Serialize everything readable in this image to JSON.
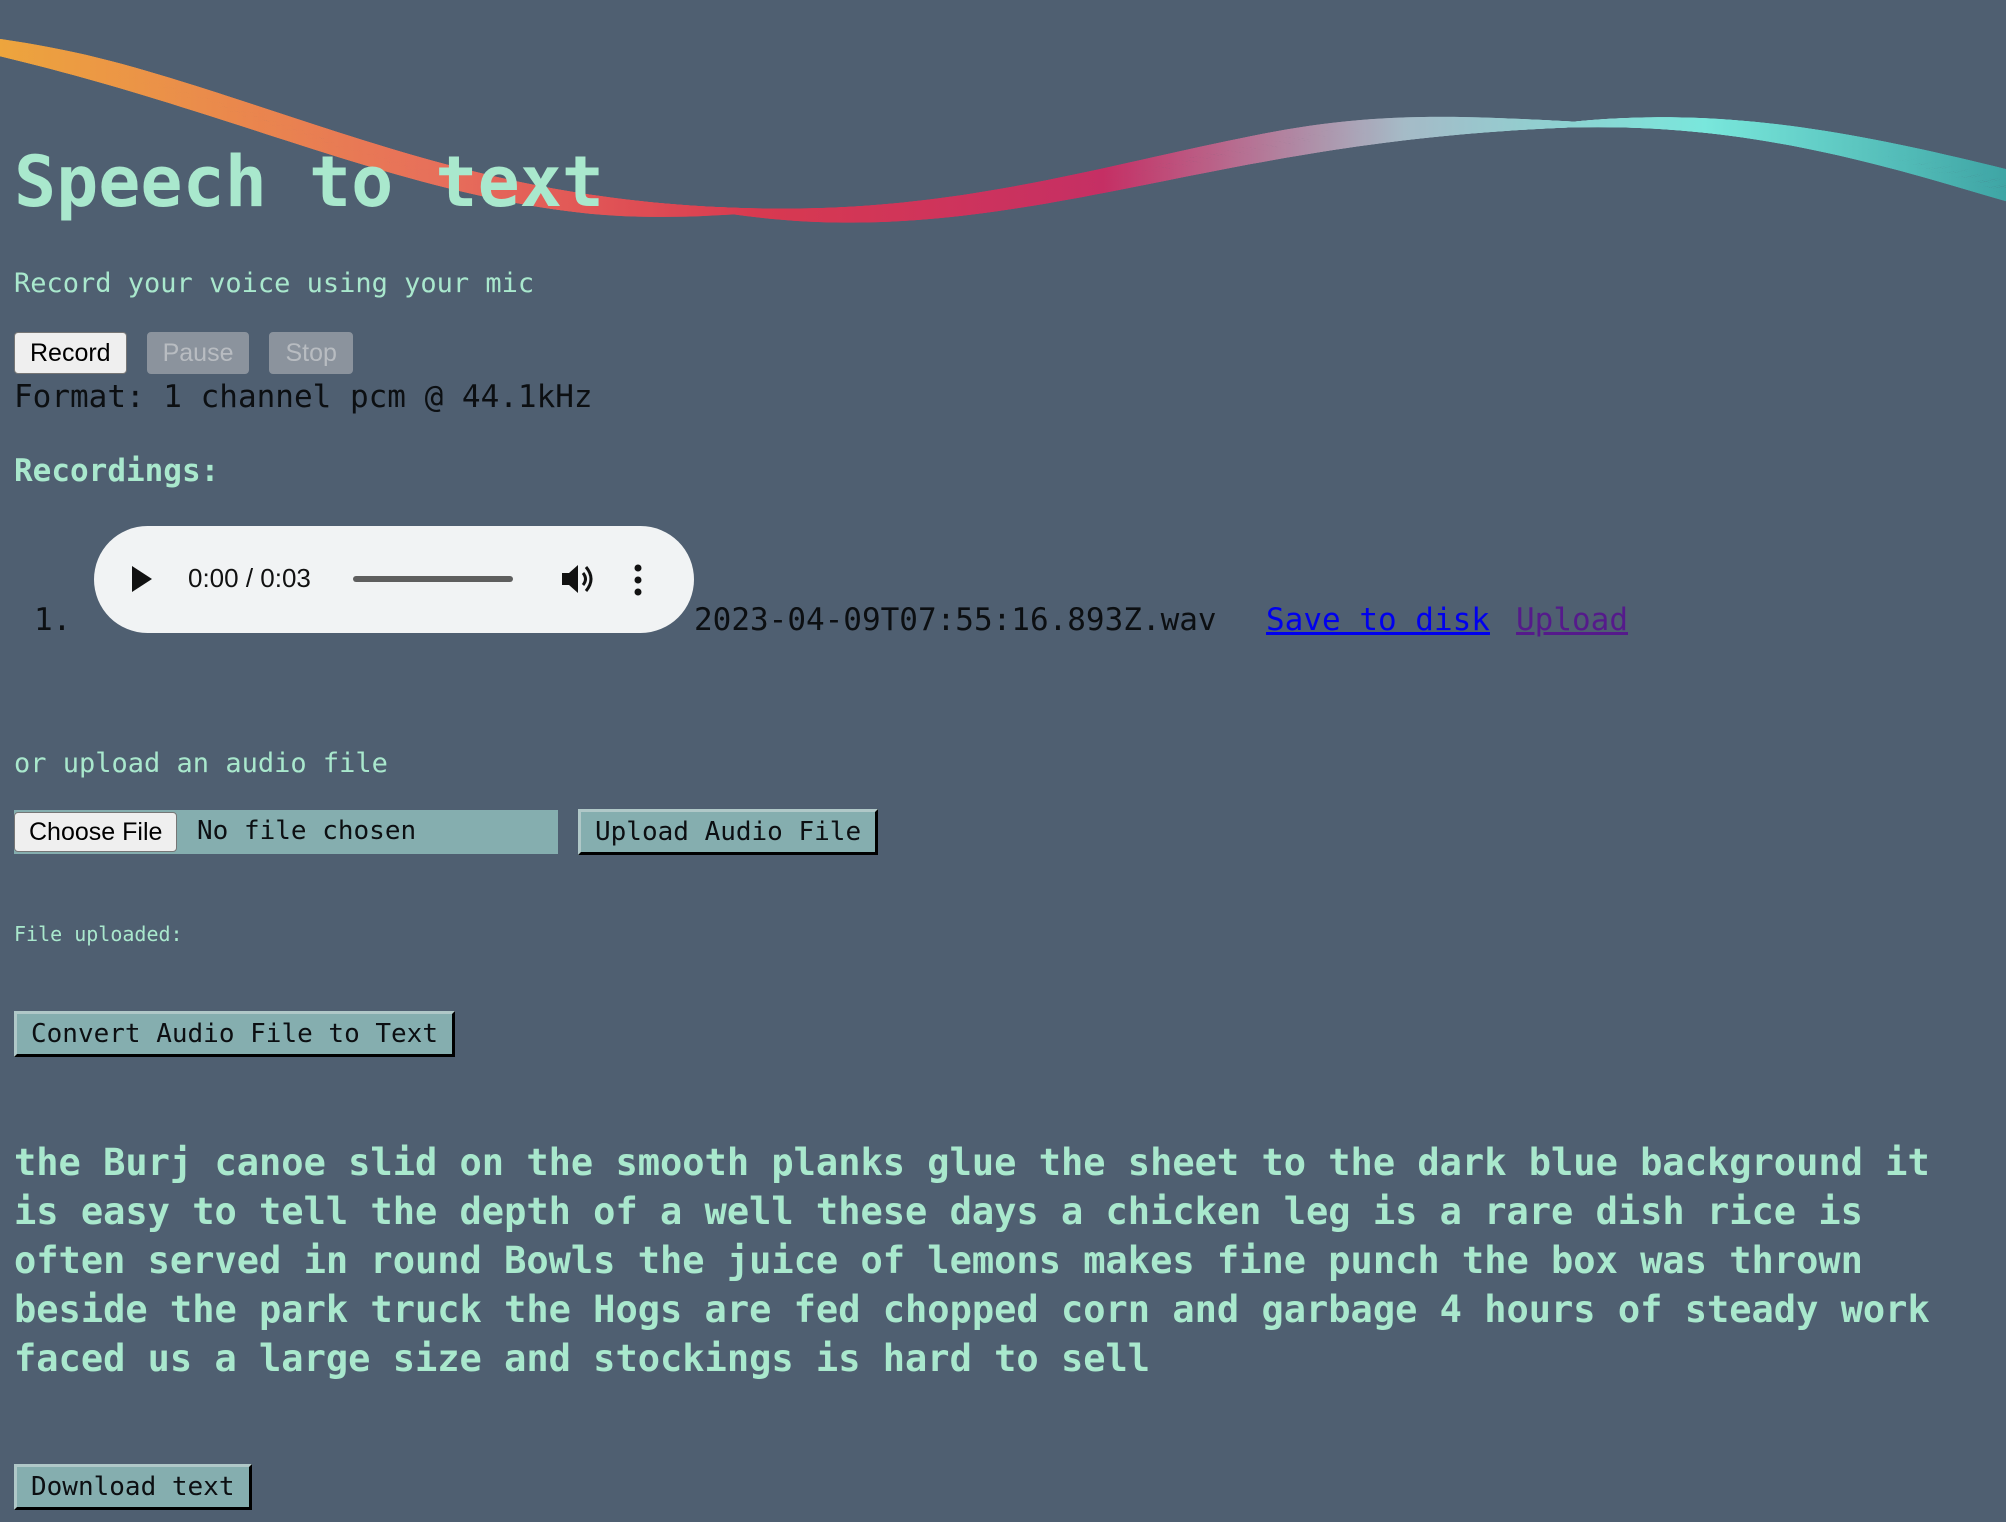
{
  "page": {
    "title": "Speech to text",
    "subtitle": "Record your voice using your mic"
  },
  "controls": {
    "record_label": "Record",
    "pause_label": "Pause",
    "stop_label": "Stop",
    "pause_enabled": false,
    "stop_enabled": false
  },
  "format_text": "Format: 1 channel pcm @ 44.1kHz",
  "recordings": {
    "title": "Recordings:",
    "items": [
      {
        "number": "1.",
        "player": {
          "time": "0:00 / 0:03",
          "icons": [
            "play-icon",
            "volume-icon",
            "more-options-icon"
          ]
        },
        "filename": "2023-04-09T07:55:16.893Z.wav",
        "save_link": "Save to disk",
        "upload_link": "Upload"
      }
    ]
  },
  "upload": {
    "label": "or upload an audio file",
    "choose_label": "Choose File",
    "no_file_text": "No file chosen",
    "upload_button": "Upload Audio File",
    "uploaded_label": "File uploaded:",
    "convert_button": "Convert Audio File to Text"
  },
  "transcript": "the Burj canoe slid on the smooth planks glue the sheet to the dark blue background it is easy to tell the depth of a well these days a chicken leg is a rare dish rice is often served in round Bowls the juice of lemons makes fine punch the box was thrown beside the park truck the Hogs are fed chopped corn and garbage 4 hours of steady work faced us a large size and stockings is hard to sell",
  "download_button": "Download text",
  "colors": {
    "background": "#4f5f71",
    "text_accent": "#a9e8cd",
    "button_teal": "#85aeaf",
    "link": "#0000ee",
    "link_visited": "#551a8b",
    "wave_gradient": [
      "#f6a93b",
      "#f0705a",
      "#e0374f",
      "#cc2d64",
      "#aac0cc",
      "#7cefe2",
      "#3ea9a8"
    ]
  }
}
